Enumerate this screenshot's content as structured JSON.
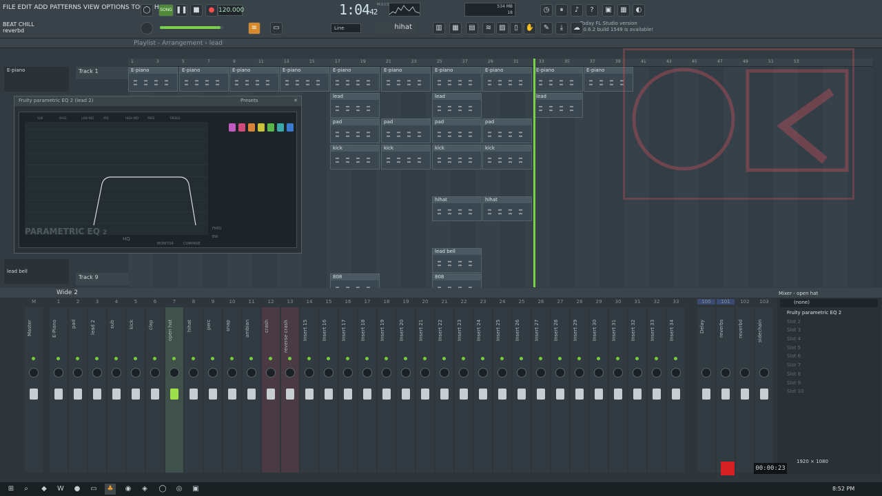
{
  "menu": [
    "FILE",
    "EDIT",
    "ADD",
    "PATTERNS",
    "VIEW",
    "OPTIONS",
    "TOOLS",
    "HELP"
  ],
  "top": {
    "song_mode": "SONG",
    "tempo": "120.000",
    "time": "1:04",
    "time_sub": "42",
    "time_unit": "M:S:CS",
    "cpu": "534 MB",
    "cpu2": "18",
    "hint_title": "BEAT CHILL",
    "hint_sub": "reverbd",
    "snap": "Line",
    "pattern": "hihat",
    "news_date": "Today",
    "news_app": "FL Studio version",
    "news_msg": "20.6.2 build 1549 is available!"
  },
  "playlist": {
    "title": "Playlist - Arrangement",
    "sep": "›",
    "pattern": "lead",
    "tracks": [
      "Track 1",
      "Track 9"
    ],
    "patterns_left": [
      "E-piano",
      "lead bell"
    ],
    "bar_numbers": [
      "1",
      "3",
      "5",
      "7",
      "9",
      "11",
      "13",
      "15",
      "17",
      "19",
      "21",
      "23",
      "25",
      "27",
      "29",
      "31",
      "33",
      "35",
      "37",
      "39",
      "41",
      "43",
      "45",
      "47",
      "49",
      "51",
      "53"
    ],
    "clips": [
      {
        "label": "E-piano",
        "row": 0,
        "c": [
          186,
          260,
          333,
          406,
          479,
          553,
          627,
          700,
          774,
          847
        ]
      },
      {
        "label": "lead",
        "row": 1,
        "c": [
          479,
          627,
          774
        ]
      },
      {
        "label": "pad",
        "row": 2,
        "c": [
          479,
          553,
          627,
          700
        ]
      },
      {
        "label": "kick",
        "row": 3,
        "c": [
          479,
          553,
          627,
          700
        ]
      },
      {
        "label": "hihat",
        "row": 5,
        "c": [
          627,
          700
        ]
      },
      {
        "label": "lead bell",
        "row": 7,
        "c": [
          627
        ]
      },
      {
        "label": "808",
        "row": 8,
        "c": [
          479,
          627
        ]
      }
    ]
  },
  "eq": {
    "title": "Fruity parametric EQ 2",
    "title_sub": "(lead 2)",
    "presets": "Presets",
    "name": "PARAMETRIC EQ",
    "name_ver": "2",
    "bands": [
      "SUB",
      "BASS",
      "LOW MID",
      "MID",
      "HIGH MID",
      "PRES",
      "TREBLE"
    ],
    "band_colors": [
      "#c05ac0",
      "#d04a78",
      "#d8823a",
      "#c9c23a",
      "#5ab84a",
      "#3aa8a8",
      "#3a7ad0"
    ],
    "btns": [
      "HQ",
      "MONITOR",
      "COMPARE"
    ],
    "freq_lbl": "FREQ",
    "bw_lbl": "BW"
  },
  "mixer": {
    "title": "Wide 2",
    "panel_title": "Mixer - open hat",
    "none": "(none)",
    "slot1": "Fruity parametric EQ 2",
    "slots": [
      "Slot 2",
      "Slot 3",
      "Slot 4",
      "Slot 5",
      "Slot 6",
      "Slot 7",
      "Slot 8",
      "Slot 9",
      "Slot 10"
    ],
    "nums": [
      "M",
      "1",
      "2",
      "3",
      "4",
      "5",
      "6",
      "7",
      "8",
      "9",
      "10",
      "11",
      "12",
      "13",
      "14",
      "15",
      "16",
      "17",
      "18",
      "19",
      "20",
      "21",
      "22",
      "23",
      "24",
      "25",
      "26",
      "27",
      "28",
      "29",
      "30",
      "31",
      "32",
      "33"
    ],
    "strips": [
      "Master",
      "E-Piano",
      "pad",
      "lead 2",
      "sub",
      "kick",
      "clap",
      "open hat",
      "hihat",
      "perc",
      "snap",
      "ambian",
      "crash",
      "reverse crash",
      "Insert 15",
      "Insert 16",
      "Insert 17",
      "Insert 18",
      "Insert 19",
      "Insert 20",
      "Insert 21",
      "Insert 22",
      "Insert 23",
      "Insert 24",
      "Insert 25",
      "Insert 26",
      "Insert 27",
      "Insert 28",
      "Insert 29",
      "Insert 30",
      "Insert 31",
      "Insert 32",
      "Insert 33",
      "Insert 34"
    ],
    "right_nums": [
      "100",
      "101",
      "102",
      "103"
    ],
    "right_strips": [
      "Delay",
      "reverbs",
      "reverbd",
      "sidechain"
    ]
  },
  "record": {
    "res": "1920 × 1080",
    "timer": "00:00:23"
  },
  "clock": "8:52 PM"
}
